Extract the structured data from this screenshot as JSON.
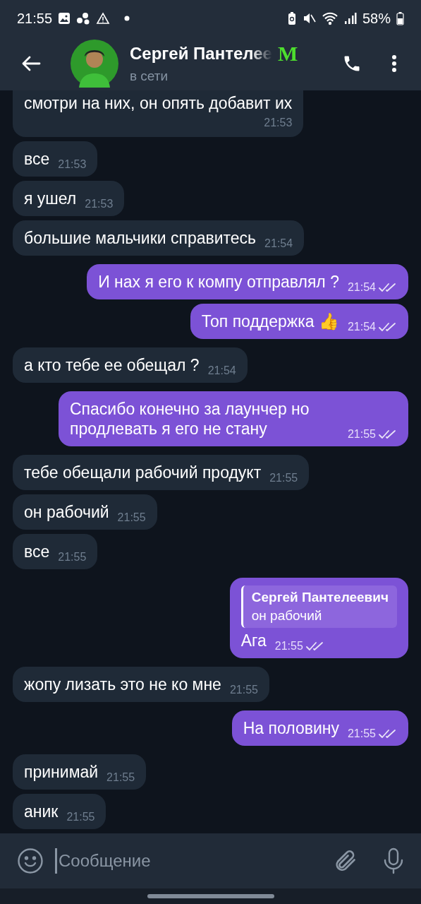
{
  "status_bar": {
    "time": "21:55",
    "battery": "58%"
  },
  "header": {
    "name": "Сергей Пантелее",
    "emoji_status": "M",
    "status": "в сети"
  },
  "messages": [
    {
      "out": false,
      "text": "смотри на них, он опять добавит их",
      "time": "21:53",
      "cut": true
    },
    {
      "out": false,
      "text": "все",
      "time": "21:53"
    },
    {
      "out": false,
      "text": "я ушел",
      "time": "21:53"
    },
    {
      "out": false,
      "text": "большие мальчики справитесь",
      "time": "21:54"
    },
    {
      "out": true,
      "text": "И нах я его к компу отправлял ?",
      "time": "21:54",
      "read": true
    },
    {
      "out": true,
      "text": "Топ поддержка 👍",
      "time": "21:54",
      "read": true
    },
    {
      "out": false,
      "text": "а кто тебе ее обещал ?",
      "time": "21:54"
    },
    {
      "out": true,
      "text": "Спасибо конечно за лаунчер но продлевать я его не стану",
      "time": "21:55",
      "read": true
    },
    {
      "out": false,
      "text": "тебе обещали рабочий продукт",
      "time": "21:55"
    },
    {
      "out": false,
      "text": "он рабочий",
      "time": "21:55"
    },
    {
      "out": false,
      "text": "все",
      "time": "21:55"
    },
    {
      "out": true,
      "reply": {
        "author": "Сергей Пантелеевич",
        "text": "он рабочий"
      },
      "text": "Ага",
      "time": "21:55",
      "read": true
    },
    {
      "out": false,
      "text": "жопу лизать это не ко мне",
      "time": "21:55"
    },
    {
      "out": true,
      "text": "На половину",
      "time": "21:55",
      "read": true
    },
    {
      "out": false,
      "text": "принимай",
      "time": "21:55"
    },
    {
      "out": false,
      "text": "аник",
      "time": "21:55"
    }
  ],
  "composer": {
    "placeholder": "Сообщение"
  }
}
